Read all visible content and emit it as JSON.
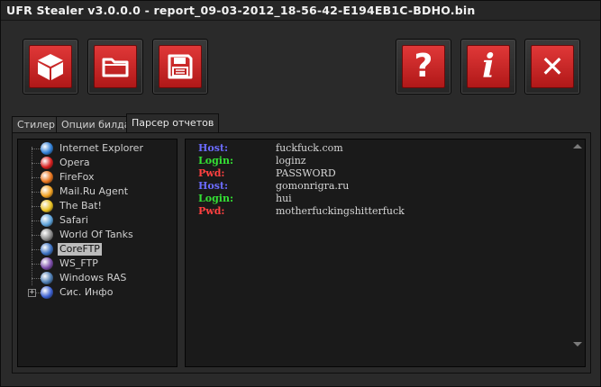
{
  "window": {
    "title": "UFR Stealer v3.0.0.0 - report_09-03-2012_18-56-42-E194EB1C-BDHO.bin"
  },
  "toolbar": {
    "buttons": [
      {
        "name": "build-button",
        "icon": "cube-icon"
      },
      {
        "name": "open-button",
        "icon": "folder-icon"
      },
      {
        "name": "save-button",
        "icon": "floppy-disk-icon"
      },
      {
        "name": "help-button",
        "icon": "question-icon",
        "glyph": "?"
      },
      {
        "name": "info-button",
        "icon": "info-icon",
        "glyph": "i"
      },
      {
        "name": "close-button",
        "icon": "close-icon",
        "glyph": "✕"
      }
    ],
    "accent": "#d12a2a"
  },
  "tabs": [
    {
      "label": "Стилер"
    },
    {
      "label": "Опции билда"
    },
    {
      "label": "Парсер отчетов",
      "active": true
    }
  ],
  "tree": {
    "items": [
      {
        "label": "Internet Explorer",
        "icon": "internet-explorer-icon",
        "color": "#2f7fd6"
      },
      {
        "label": "Opera",
        "icon": "opera-icon",
        "color": "#d81e1e"
      },
      {
        "label": "FireFox",
        "icon": "firefox-icon",
        "color": "#e8741c"
      },
      {
        "label": "Mail.Ru Agent",
        "icon": "mailru-agent-icon",
        "color": "#f0a020"
      },
      {
        "label": "The Bat!",
        "icon": "the-bat-icon",
        "color": "#e8c020"
      },
      {
        "label": "Safari",
        "icon": "safari-icon",
        "color": "#5aa0d8"
      },
      {
        "label": "World Of Tanks",
        "icon": "world-of-tanks-icon",
        "color": "#8a8a8a"
      },
      {
        "label": "CoreFTP",
        "icon": "coreftp-icon",
        "color": "#3a6fc0",
        "selected": true
      },
      {
        "label": "WS_FTP",
        "icon": "ws-ftp-icon",
        "color": "#7a4aa8"
      },
      {
        "label": "Windows RAS",
        "icon": "windows-ras-icon",
        "color": "#4a7ab0"
      },
      {
        "label": "Сис. Инфо",
        "icon": "system-info-icon",
        "color": "#3a5fd0",
        "expandable": true
      }
    ],
    "expander_glyph": "+"
  },
  "report": {
    "lines": [
      {
        "key": "Host:",
        "value": "fuckfuck.com",
        "color": "#6b6bff"
      },
      {
        "key": "Login:",
        "value": "loginz",
        "color": "#34e034"
      },
      {
        "key": "Pwd:",
        "value": "PASSWORD",
        "color": "#ff4040"
      },
      {
        "key": "Host:",
        "value": "gomonrigra.ru",
        "color": "#6b6bff"
      },
      {
        "key": "Login:",
        "value": "hui",
        "color": "#34e034"
      },
      {
        "key": "Pwd:",
        "value": "motherfuckingshitterfuck",
        "color": "#ff4040"
      }
    ]
  }
}
